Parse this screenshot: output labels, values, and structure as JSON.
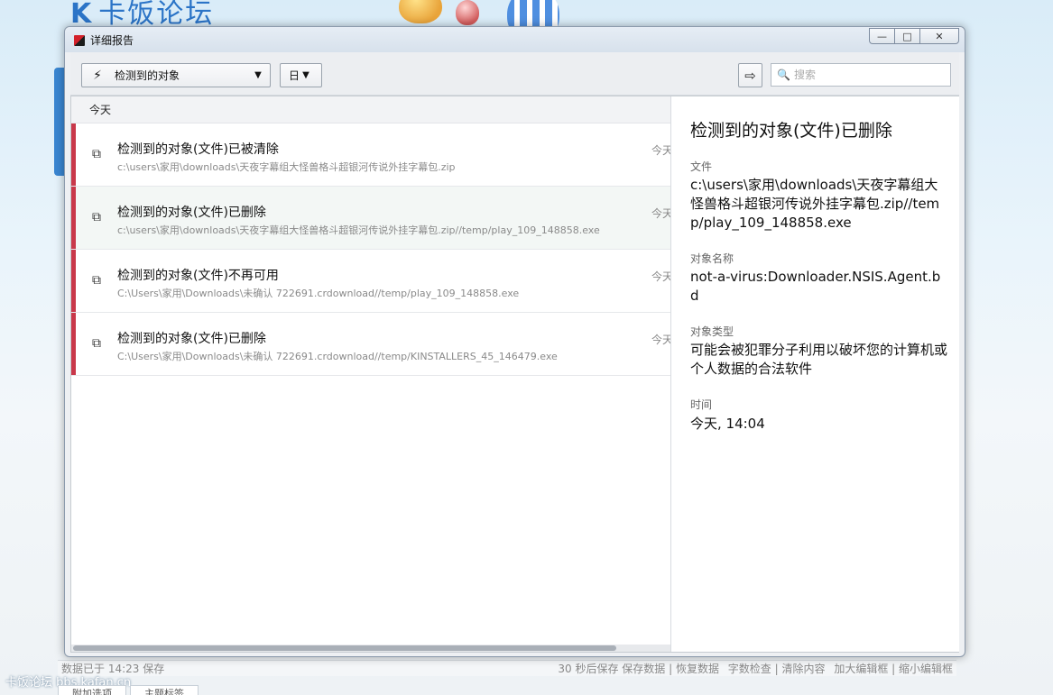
{
  "background": {
    "logo_text": "卡饭论坛",
    "status_left": "数据已于 14:23 保存",
    "status_right": [
      "30 秒后保存 保存数据 | 恢复数据",
      "字数检查 | 清除内容",
      "加大编辑框 | 缩小编辑框"
    ],
    "watermark": "卡饭论坛 bbs.kafan.cn",
    "tabs": [
      "附加选项",
      "主题标签"
    ]
  },
  "window": {
    "title": "详细报告",
    "controls": {
      "minimize": "—",
      "maximize": "□",
      "close": "✕"
    }
  },
  "toolbar": {
    "filter_object": "检测到的对象",
    "filter_period": "日",
    "search_placeholder": "搜索",
    "export_icon": "export-icon"
  },
  "list": {
    "group": "今天",
    "rows": [
      {
        "title": "检测到的对象(文件)已被清除",
        "path": "c:\\users\\家用\\downloads\\天夜字幕组大怪兽格斗超银河传说外挂字幕包.zip",
        "time": "今天"
      },
      {
        "title": "检测到的对象(文件)已删除",
        "path": "c:\\users\\家用\\downloads\\天夜字幕组大怪兽格斗超银河传说外挂字幕包.zip//temp/play_109_148858.exe",
        "time": "今天"
      },
      {
        "title": "检测到的对象(文件)不再可用",
        "path": "C:\\Users\\家用\\Downloads\\未确认 722691.crdownload//temp/play_109_148858.exe",
        "time": "今天"
      },
      {
        "title": "检测到的对象(文件)已删除",
        "path": "C:\\Users\\家用\\Downloads\\未确认 722691.crdownload//temp/KINSTALLERS_45_146479.exe",
        "time": "今天"
      }
    ]
  },
  "detail": {
    "title": "检测到的对象(文件)已删除",
    "file_label": "文件",
    "file_value": "c:\\users\\家用\\downloads\\天夜字幕组大怪兽格斗超银河传说外挂字幕包.zip//temp/play_109_148858.exe",
    "name_label": "对象名称",
    "name_value": "not-a-virus:Downloader.NSIS.Agent.bd",
    "type_label": "对象类型",
    "type_value": "可能会被犯罪分子利用以破坏您的计算机或个人数据的合法软件",
    "time_label": "时间",
    "time_value": "今天, 14:04"
  },
  "colors": {
    "accent_red": "#c9384a",
    "row_alt": "#f3f7f5"
  }
}
